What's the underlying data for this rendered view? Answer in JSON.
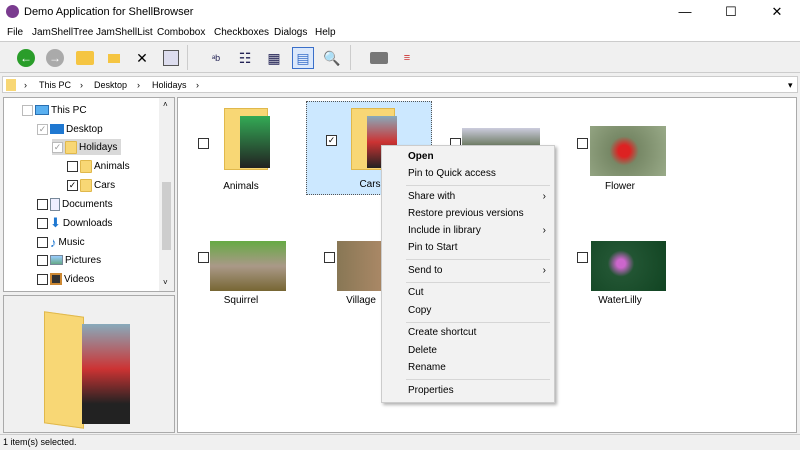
{
  "window": {
    "title": "Demo Application for ShellBrowser",
    "minimize": "—",
    "maximize": "☐",
    "close": "✕"
  },
  "menubar": [
    "File",
    "JamShellTree",
    "JamShellList",
    "Combobox",
    "Checkboxes",
    "Dialogs",
    "Help"
  ],
  "toolbar": {
    "back": "back-icon",
    "forward": "forward-icon",
    "up": "folder-up-icon",
    "new_folder": "new-folder-icon",
    "delete": "✕",
    "properties": "properties-icon"
  },
  "address": {
    "crumbs": [
      "This PC",
      "Desktop",
      "Holidays"
    ],
    "sep": "›",
    "dropdown": "▾"
  },
  "tree": [
    {
      "label": "This PC",
      "checked": false
    },
    {
      "label": "Desktop",
      "checked": true
    },
    {
      "label": "Holidays",
      "checked": true,
      "selected": true
    },
    {
      "label": "Animals",
      "checked": false
    },
    {
      "label": "Cars",
      "checked": true
    },
    {
      "label": "Documents",
      "checked": false
    },
    {
      "label": "Downloads",
      "checked": false
    },
    {
      "label": "Music",
      "checked": false
    },
    {
      "label": "Pictures",
      "checked": false
    },
    {
      "label": "Videos",
      "checked": false
    }
  ],
  "items": [
    {
      "label": "Animals",
      "checked": false
    },
    {
      "label": "Cars",
      "checked": true,
      "selected": true
    },
    {
      "label": "",
      "checked": false
    },
    {
      "label": "Flower",
      "checked": false
    },
    {
      "label": "Squirrel",
      "checked": false
    },
    {
      "label": "Village",
      "checked": false
    },
    {
      "label": "",
      "checked": false
    },
    {
      "label": "WaterLilly",
      "checked": false
    }
  ],
  "context_menu": {
    "open": "Open",
    "pin_quick": "Pin to Quick access",
    "share": "Share with",
    "restore": "Restore previous versions",
    "include": "Include in library",
    "pin_start": "Pin to Start",
    "send_to": "Send to",
    "cut": "Cut",
    "copy": "Copy",
    "create_shortcut": "Create shortcut",
    "delete": "Delete",
    "rename": "Rename",
    "properties": "Properties",
    "submenu_arrow": "›"
  },
  "status": "1 item(s) selected.",
  "colors": {
    "selection": "#cce8ff",
    "selection_border": "#99d1ff",
    "folder": "#f8d775"
  }
}
